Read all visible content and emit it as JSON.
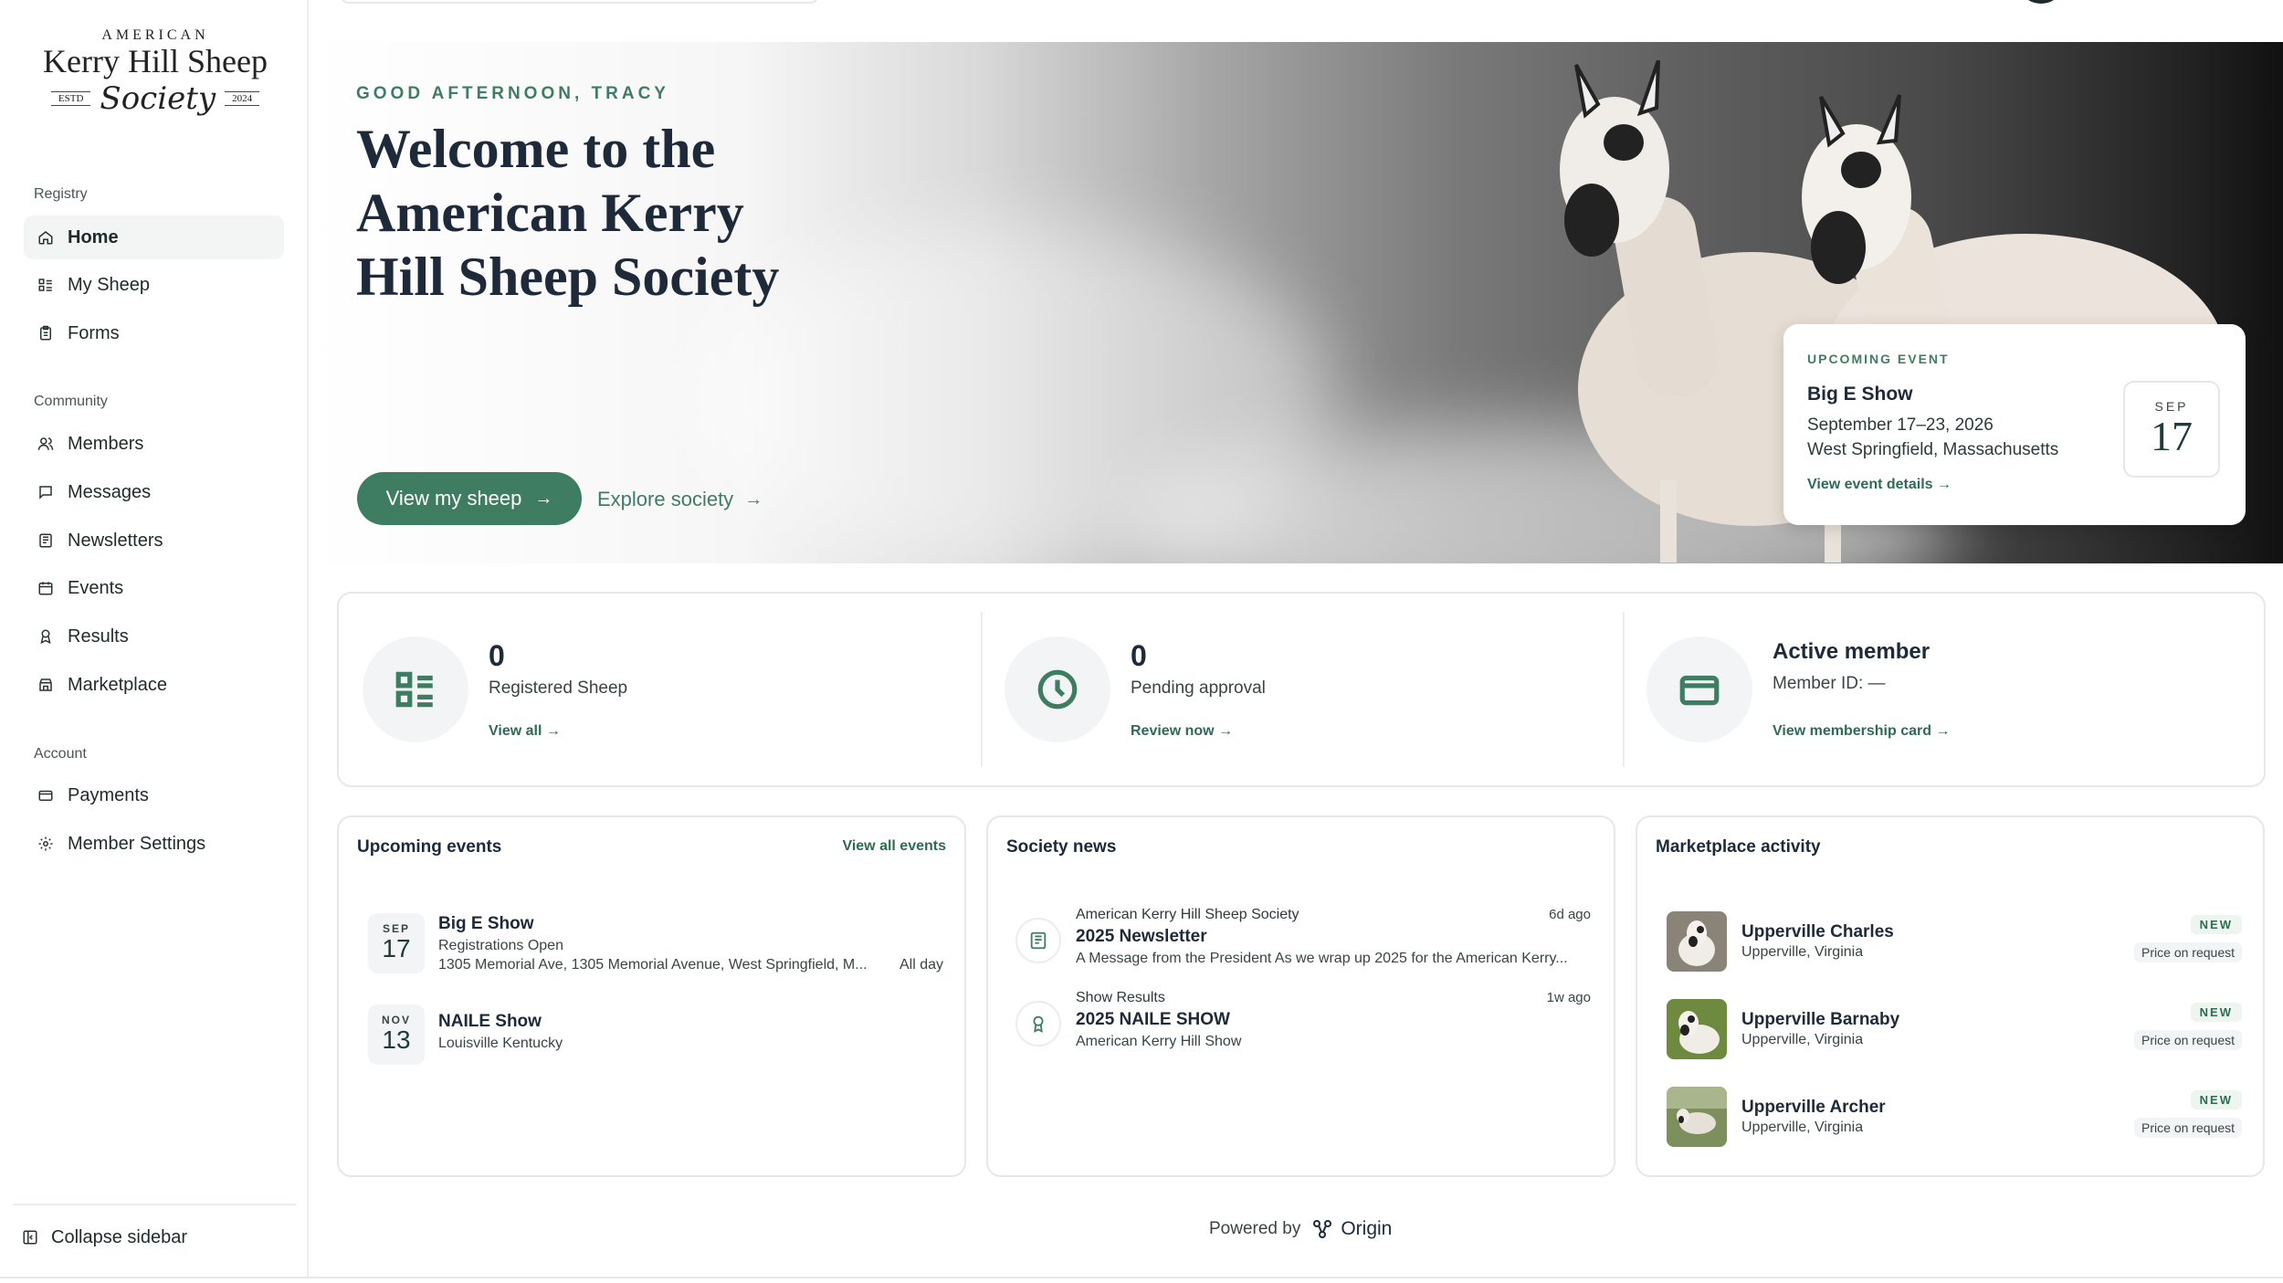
{
  "logo": {
    "line1": "AMERICAN",
    "line2": "Kerry Hill Sheep",
    "estd": "ESTD",
    "script": "Society",
    "year": "2024"
  },
  "sidebar": {
    "sections": [
      {
        "label": "Registry",
        "items": [
          "Home",
          "My Sheep",
          "Forms"
        ]
      },
      {
        "label": "Community",
        "items": [
          "Members",
          "Messages",
          "Newsletters",
          "Events",
          "Results",
          "Marketplace"
        ]
      },
      {
        "label": "Account",
        "items": [
          "Payments",
          "Member Settings"
        ]
      }
    ],
    "active": "Home",
    "collapse_label": "Collapse sidebar"
  },
  "hero": {
    "greeting": "GOOD AFTERNOON, TRACY",
    "title": "Welcome to the American Kerry Hill Sheep Society",
    "primary_button": "View my sheep",
    "secondary_link": "Explore society",
    "event": {
      "tag": "UPCOMING EVENT",
      "name": "Big E Show",
      "dates": "September 17–23, 2026",
      "location": "West Springfield, Massachusetts",
      "details_link": "View event details",
      "month": "SEP",
      "day": "17"
    }
  },
  "stats": [
    {
      "value": "0",
      "label": "Registered Sheep",
      "link": "View all",
      "icon": "list-icon"
    },
    {
      "value": "0",
      "label": "Pending approval",
      "link": "Review now",
      "icon": "clock-icon"
    },
    {
      "title": "Active member",
      "sub": "Member ID: —",
      "link": "View membership card",
      "icon": "card-icon"
    }
  ],
  "events_panel": {
    "title": "Upcoming events",
    "link": "View all events",
    "items": [
      {
        "month": "SEP",
        "day": "17",
        "name": "Big E Show",
        "line1": "Registrations Open",
        "line2": "1305 Memorial Ave, 1305 Memorial Avenue, West Springfield, M...",
        "allday": "All day"
      },
      {
        "month": "NOV",
        "day": "13",
        "name": "NAILE Show",
        "line1": "Louisville Kentucky",
        "line2": "",
        "allday": ""
      }
    ]
  },
  "news_panel": {
    "title": "Society news",
    "items": [
      {
        "source": "American Kerry Hill Sheep Society",
        "ago": "6d ago",
        "title": "2025 Newsletter",
        "excerpt": "A Message from the President As we wrap up 2025 for the American Kerry...",
        "icon": "newspaper-icon"
      },
      {
        "source": "Show Results",
        "ago": "1w ago",
        "title": "2025 NAILE SHOW",
        "excerpt": "American Kerry Hill Show",
        "icon": "award-icon"
      }
    ]
  },
  "market_panel": {
    "title": "Marketplace activity",
    "items": [
      {
        "name": "Upperville Charles",
        "location": "Upperville, Virginia",
        "badge": "NEW",
        "price": "Price on request",
        "bg": "#8a8478"
      },
      {
        "name": "Upperville Barnaby",
        "location": "Upperville, Virginia",
        "badge": "NEW",
        "price": "Price on request",
        "bg": "#6e8a3f"
      },
      {
        "name": "Upperville Archer",
        "location": "Upperville, Virginia",
        "badge": "NEW",
        "price": "Price on request",
        "bg": "#7d8f5c"
      }
    ]
  },
  "footer": {
    "powered_by": "Powered by",
    "brand": "Origin"
  },
  "colors": {
    "accent": "#3f7d62",
    "text": "#1e2a3a"
  }
}
